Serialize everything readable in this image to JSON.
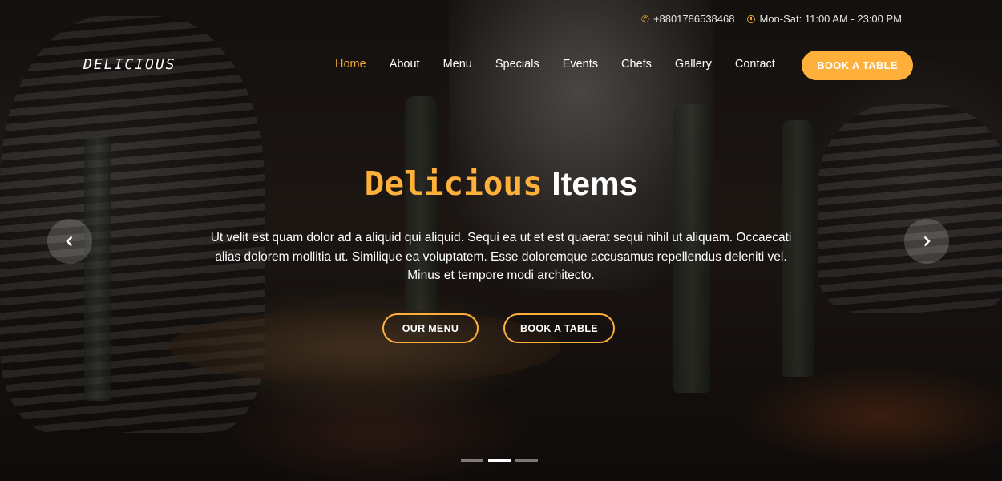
{
  "topbar": {
    "phone": "+8801786538468",
    "hours": "Mon-Sat: 11:00 AM - 23:00 PM"
  },
  "logo": "DELICIOUS",
  "nav": {
    "items": [
      {
        "label": "Home",
        "active": true
      },
      {
        "label": "About"
      },
      {
        "label": "Menu"
      },
      {
        "label": "Specials"
      },
      {
        "label": "Events"
      },
      {
        "label": "Chefs"
      },
      {
        "label": "Gallery"
      },
      {
        "label": "Contact"
      }
    ],
    "book_button": "BOOK A TABLE"
  },
  "hero": {
    "title_accent": "Delicious",
    "title_rest": "Items",
    "text": "Ut velit est quam dolor ad a aliquid qui aliquid. Sequi ea ut et est quaerat sequi nihil ut aliquam. Occaecati alias dolorem mollitia ut. Similique ea voluptatem. Esse doloremque accusamus repellendus deleniti vel. Minus et tempore modi architecto.",
    "menu_button": "OUR MENU",
    "book_button": "BOOK A TABLE"
  },
  "carousel": {
    "slides": 3,
    "active_index": 1
  },
  "colors": {
    "accent": "#ffb03b",
    "text": "#ffffff"
  }
}
